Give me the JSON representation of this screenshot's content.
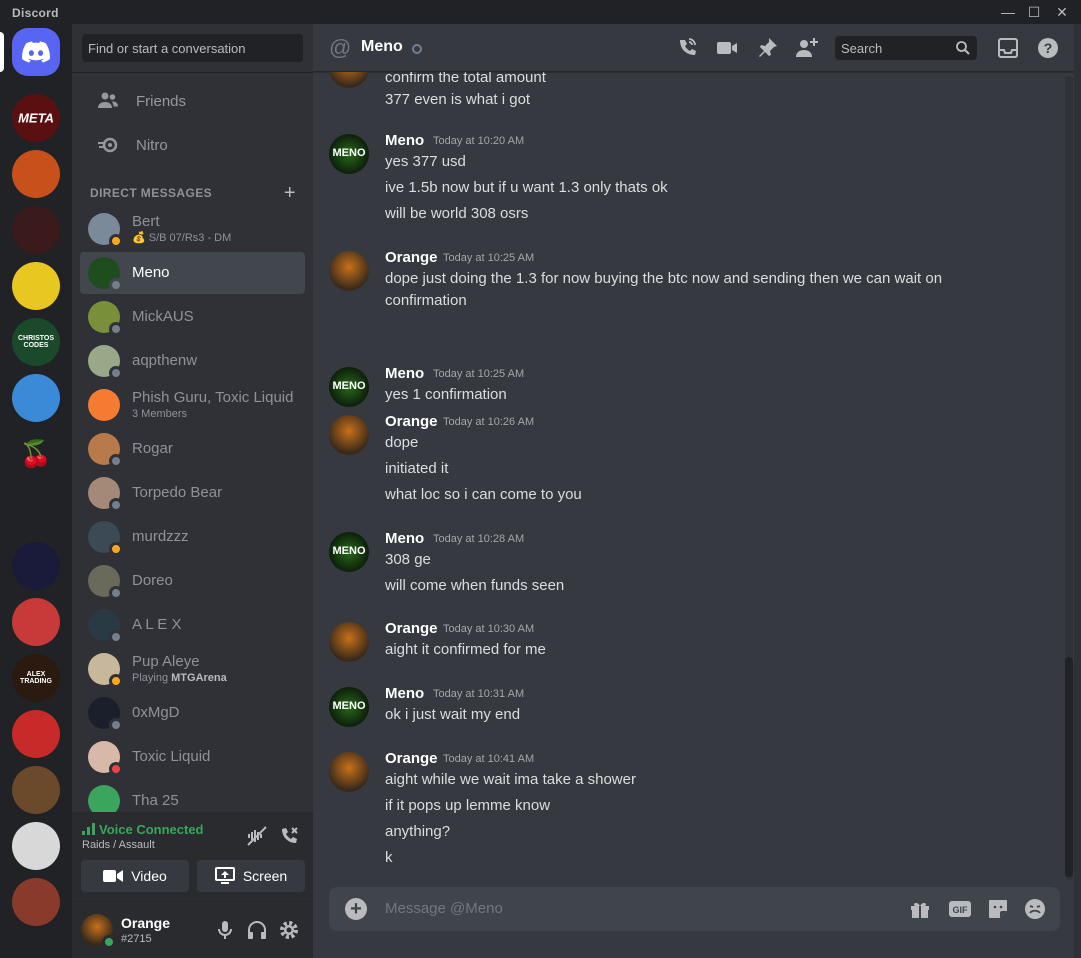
{
  "window": {
    "brand": "Discord",
    "controls": [
      "—",
      "☐",
      "✕"
    ]
  },
  "sidebar": {
    "search_placeholder": "Find or start a conversation",
    "nav": [
      {
        "label": "Friends",
        "icon": "friends-icon"
      },
      {
        "label": "Nitro",
        "icon": "nitro-icon"
      }
    ],
    "dm_header": "DIRECT MESSAGES",
    "dms": [
      {
        "name": "Bert",
        "sub": "💰 S/B 07/Rs3 - DM",
        "status": "idle",
        "color": "#7a8a9a"
      },
      {
        "name": "Meno",
        "sub": "",
        "status": "offline",
        "color": "#1e4d1e",
        "active": true
      },
      {
        "name": "MickAUS",
        "sub": "",
        "status": "offline",
        "color": "#7a8f3a"
      },
      {
        "name": "aqpthenw",
        "sub": "",
        "status": "offline",
        "color": "#9aa88a"
      },
      {
        "name": "Phish Guru, Toxic Liquid",
        "sub": "3 Members",
        "status": "",
        "color": "#f47b31"
      },
      {
        "name": "Rogar",
        "sub": "",
        "status": "offline",
        "color": "#b87a4a"
      },
      {
        "name": "Torpedo Bear",
        "sub": "",
        "status": "offline",
        "color": "#a48878"
      },
      {
        "name": "murdzzz",
        "sub": "",
        "status": "idle",
        "color": "#3b4a55"
      },
      {
        "name": "Doreo",
        "sub": "",
        "status": "offline",
        "color": "#6a6a5a"
      },
      {
        "name": "A L E X",
        "sub": "",
        "status": "offline",
        "color": "#2a3a45"
      },
      {
        "name": "Pup Aleye",
        "sub_prefix": "Playing ",
        "sub_bold": "MTGArena",
        "status": "idle",
        "color": "#c8b89a"
      },
      {
        "name": "0xMgD",
        "sub": "",
        "status": "offline",
        "color": "#1a1f2b"
      },
      {
        "name": "Toxic Liquid",
        "sub": "",
        "status": "dnd",
        "color": "#d8b8a8"
      },
      {
        "name": "Tha 25",
        "sub": "",
        "status": "",
        "color": "#3ba55d"
      }
    ],
    "voice": {
      "status": "Voice Connected",
      "channel": "Raids / Assault",
      "video_label": "Video",
      "screen_label": "Screen"
    },
    "user": {
      "name": "Orange",
      "tag": "#2715"
    }
  },
  "chat": {
    "channel": "Meno",
    "search_placeholder": "Search",
    "composer_placeholder": "Message @Meno",
    "top_lines": [
      "confirm the total amount",
      "377 even is what i got"
    ],
    "groups": [
      {
        "author": "Meno",
        "time": "Today at 10:20 AM",
        "lines": [
          "yes 377 usd",
          "ive 1.5b now but if u want 1.3 only thats ok",
          "will be world 308 osrs"
        ]
      },
      {
        "author": "Orange",
        "time": "Today at 10:25 AM",
        "lines": [
          "dope just doing the 1.3 for now buying the btc now and sending then we can wait on",
          "confirmation"
        ]
      },
      {
        "author": "Meno",
        "time": "Today at 10:25 AM",
        "lines": [
          "yes 1 confirmation"
        ]
      },
      {
        "author": "Orange",
        "time": "Today at 10:26 AM",
        "lines": [
          "dope",
          "initiated it",
          "what loc so i can come to you"
        ]
      },
      {
        "author": "Meno",
        "time": "Today at 10:28 AM",
        "lines": [
          "308 ge",
          "will come when funds seen"
        ]
      },
      {
        "author": "Orange",
        "time": "Today at 10:30 AM",
        "lines": [
          "aight it confirmed for me"
        ]
      },
      {
        "author": "Meno",
        "time": "Today at 10:31 AM",
        "lines": [
          "ok i just wait my end"
        ]
      },
      {
        "author": "Orange",
        "time": "Today at 10:41 AM",
        "lines": [
          "aight while we wait ima take a shower",
          "if it pops up lemme know",
          "anything?",
          "k"
        ]
      }
    ]
  },
  "servers": [
    {
      "label": "META",
      "color": "#5a1010"
    },
    {
      "label": "",
      "color": "#c8501a"
    },
    {
      "label": "",
      "color": "#3a1a1a"
    },
    {
      "label": "",
      "color": "#e8c820"
    },
    {
      "label": "CHRISTOS CODES",
      "color": "#1a4a2a"
    },
    {
      "label": "",
      "color": "#3a8ad8"
    },
    {
      "label": "🍒",
      "color": "#202225"
    },
    {
      "label": "",
      "color": "#202225"
    },
    {
      "label": "",
      "color": "#1a1a3a"
    },
    {
      "label": "",
      "color": "#c83a3a"
    },
    {
      "label": "ALEX TRADING",
      "color": "#2a1a10"
    },
    {
      "label": "",
      "color": "#c82a2a"
    },
    {
      "label": "",
      "color": "#6a4a2a"
    },
    {
      "label": "",
      "color": "#d8d8d8"
    },
    {
      "label": "",
      "color": "#8a3a2a"
    }
  ],
  "colors": {
    "accent": "#5865f2",
    "online": "#3ba55d",
    "idle": "#faa81a",
    "dnd": "#ed4245",
    "offline": "#747f8d"
  }
}
